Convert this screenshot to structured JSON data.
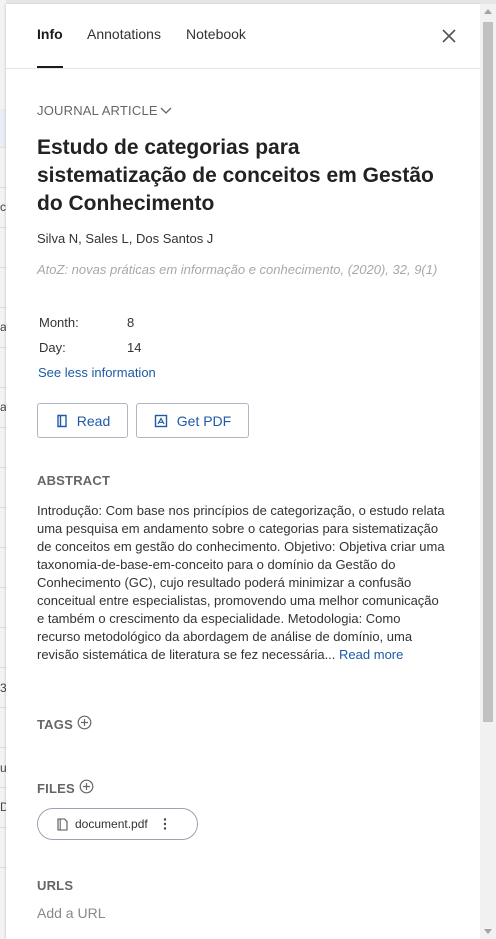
{
  "background": {
    "fragments": [
      "c",
      "a",
      "a",
      "3",
      "up",
      "D"
    ]
  },
  "tabs": [
    {
      "label": "Info",
      "active": true
    },
    {
      "label": "Annotations",
      "active": false
    },
    {
      "label": "Notebook",
      "active": false
    }
  ],
  "icons": {
    "close": "close-icon",
    "chevron": "chevron-down-icon",
    "read": "book-icon",
    "pdf": "pdf-icon",
    "add": "plus-circle-icon",
    "file": "file-icon",
    "more": "more-vertical-icon"
  },
  "article": {
    "type_label": "JOURNAL ARTICLE",
    "title": "Estudo de categorias para sistematização de conceitos em Gestão do Conhecimento",
    "authors": "Silva N, Sales L, Dos Santos J",
    "source": "AtoZ: novas práticas em informação e conhecimento, (2020), 32, 9(1)",
    "meta": [
      {
        "key": "Month:",
        "value": "8"
      },
      {
        "key": "Day:",
        "value": "14"
      }
    ],
    "see_less": "See less information"
  },
  "buttons": {
    "read": "Read",
    "get_pdf": "Get PDF"
  },
  "abstract": {
    "heading": "ABSTRACT",
    "text": "Introdução: Com base nos princípios de categorização, o estudo relata uma pesquisa em andamento sobre o categorias para sistematização de conceitos em gestão do conhecimento. Objetivo: Objetiva criar uma taxonomia-de-base-em-conceito para o domínio da Gestão do Conhecimento (GC), cujo resultado poderá minimizar a confusão conceitual entre especialistas, promovendo uma melhor comunicação e também o crescimento da especialidade. Metodologia: Como recurso metodológico da abordagem de análise de domínio, uma revisão sistemática de literatura se fez necessária...",
    "read_more": "Read more"
  },
  "tags": {
    "heading": "TAGS"
  },
  "files": {
    "heading": "FILES",
    "items": [
      {
        "name": "document.pdf"
      }
    ]
  },
  "urls": {
    "heading": "URLS",
    "add_label": "Add a URL"
  },
  "colors": {
    "accent": "#1e5aa8",
    "muted": "#666666",
    "source_text": "#a8a8a8"
  }
}
